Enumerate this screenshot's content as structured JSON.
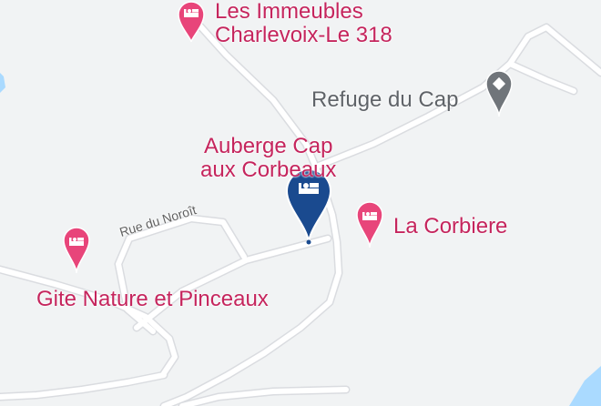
{
  "map": {
    "colors": {
      "background": "#f1f3f4",
      "road": "#ffffff",
      "road_casing": "#dadce0",
      "water": "#aadaff",
      "hotel_pin": "#e8457a",
      "selected_pin": "#1a4a8f",
      "gray_pin": "#70757a"
    },
    "roads": [
      {
        "name": "Rue du Noroît"
      }
    ],
    "places": [
      {
        "name_line1": "Les Immeubles",
        "name_line2": "Charlevoix-Le 318",
        "icon": "hotel-bed-icon"
      },
      {
        "name": "Refuge du Cap",
        "icon": "generic-place-pin-icon"
      },
      {
        "name_line1": "Auberge Cap",
        "name_line2": "aux Corbeaux",
        "icon": "selected-hotel-pin-icon",
        "selected": true
      },
      {
        "name": "La Corbiere",
        "icon": "hotel-bed-icon"
      },
      {
        "name": "Gite Nature et Pinceaux",
        "icon": "hotel-bed-icon"
      }
    ]
  }
}
